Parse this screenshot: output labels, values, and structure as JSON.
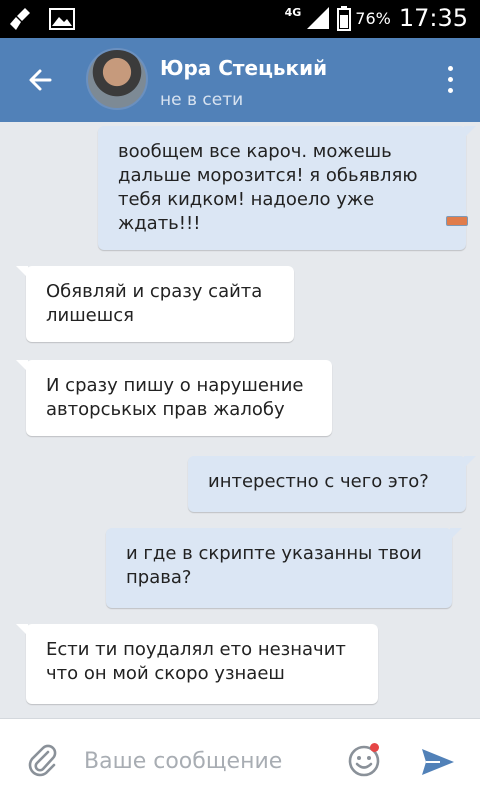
{
  "status_bar": {
    "network": "4G",
    "battery": "76%",
    "time": "17:35",
    "icons": [
      "cleaner-icon",
      "gallery-icon",
      "signal-icon",
      "battery-icon"
    ]
  },
  "header": {
    "name": "Юра Стецький",
    "presence": "не в сети",
    "icons": [
      "back-arrow-icon",
      "overflow-menu-icon"
    ]
  },
  "messages": [
    {
      "direction": "out",
      "text": "вообщем все кароч. можешь дальше морозится! я обьявляю тебя кидком! надоело уже ждать!!!"
    },
    {
      "direction": "in",
      "text": "Обявляй и сразу сайта лишешся"
    },
    {
      "direction": "in",
      "text": "И сразу пишу о нарушение авторськых прав жалобу"
    },
    {
      "direction": "out",
      "text": "интерестно с чего это?"
    },
    {
      "direction": "out",
      "text": "и где в скрипте указанны твои права?"
    },
    {
      "direction": "in",
      "text": "Ести ти поудалял ето незначит что он мой скоро узнаеш"
    }
  ],
  "composer": {
    "placeholder": "Ваше сообщение",
    "value": "",
    "icons": [
      "paperclip-icon",
      "emoji-icon",
      "send-icon"
    ]
  },
  "colors": {
    "header": "#5181b8",
    "outgoing_bubble": "#dbe6f4",
    "incoming_bubble": "#ffffff",
    "background": "#e6e9ed",
    "accent": "#5181b8"
  }
}
